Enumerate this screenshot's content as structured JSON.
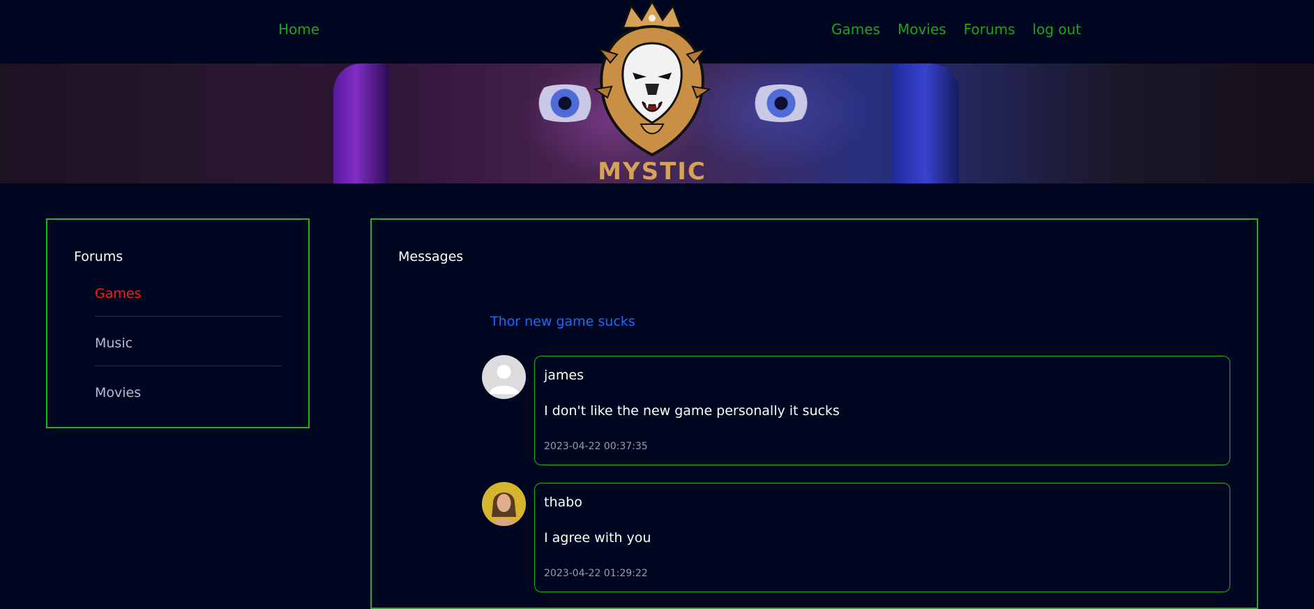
{
  "nav": {
    "home": "Home",
    "links": [
      "Games",
      "Movies",
      "Forums",
      "log out"
    ]
  },
  "logo": {
    "text": "MYSTIC"
  },
  "sidebar": {
    "title": "Forums",
    "items": [
      {
        "label": "Games",
        "active": true
      },
      {
        "label": "Music",
        "active": false
      },
      {
        "label": "Movies",
        "active": false
      }
    ]
  },
  "messages": {
    "title": "Messages",
    "topic": "Thor new game sucks",
    "posts": [
      {
        "user": "james",
        "text": "I don't like the new game personally it sucks",
        "time": "2023-04-22 00:37:35",
        "avatar": "default-avatar-icon"
      },
      {
        "user": "thabo",
        "text": "I agree with you",
        "time": "2023-04-22 01:29:22",
        "avatar": "user-photo"
      }
    ]
  },
  "colors": {
    "background": "#00061f",
    "accent_green": "#1fb41f",
    "active_red": "#ff1a1a",
    "link_blue": "#1a6bff"
  }
}
